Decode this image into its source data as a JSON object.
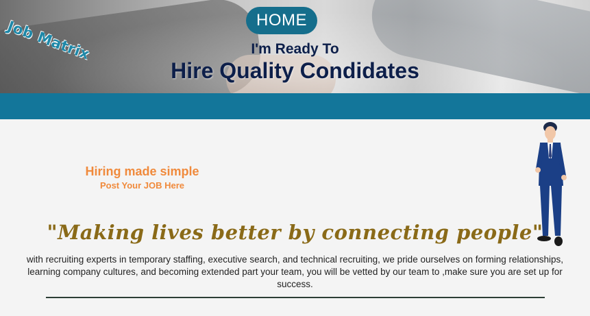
{
  "header": {
    "logo_text": "Job Matrix",
    "home_label": "HOME",
    "tagline_small": "I'm Ready To",
    "tagline_big": "Hire Quality Condidates"
  },
  "hiring": {
    "headline": "Hiring made simple",
    "cta": "Post Your JOB Here"
  },
  "main": {
    "quote": "\"Making lives better by connecting people\"",
    "description": "with recruiting experts in temporary staffing, executive search, and technical recruiting, we pride ourselves on forming relationships, learning company cultures, and becoming extended part your team, you will be vetted by our team to ,make sure you are set up for success."
  },
  "colors": {
    "band": "#13769a",
    "home_pill": "#156e8c",
    "tagline": "#0d1f4a",
    "hiring_orange": "#f08a3c",
    "quote_gold": "#8a6a18"
  },
  "icons": {
    "hero_image": "handshake-photo",
    "person_image": "businessman-illustration"
  }
}
